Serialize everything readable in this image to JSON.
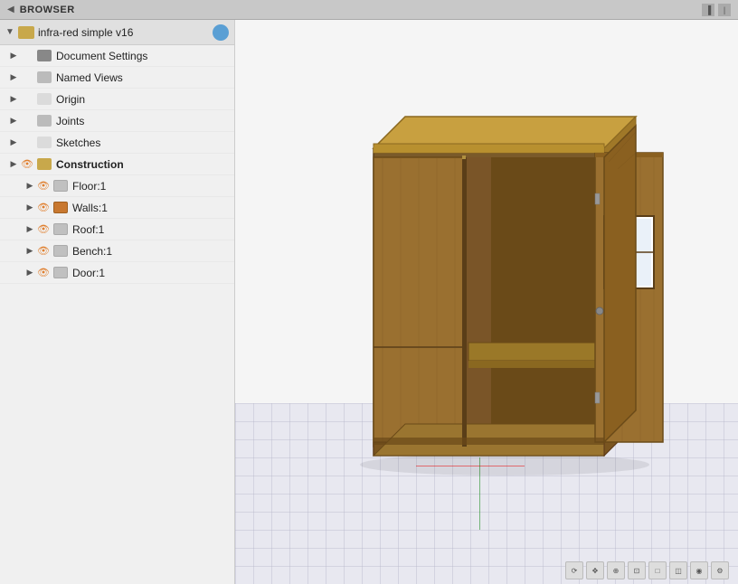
{
  "titleBar": {
    "label": "BROWSER",
    "backIcon": "◀",
    "collapseIcon": "▐▌"
  },
  "rootItem": {
    "label": "infra-red simple v16",
    "folderIcon": "folder-icon",
    "eyeIcon": "eye-icon"
  },
  "treeItems": [
    {
      "id": "doc-settings",
      "label": "Document Settings",
      "indent": 1,
      "hasExpand": true,
      "iconType": "icon-gear",
      "hasEye": false,
      "eyeOpen": false
    },
    {
      "id": "named-views",
      "label": "Named Views",
      "indent": 1,
      "hasExpand": true,
      "iconType": "icon-folder-gray",
      "hasEye": false,
      "eyeOpen": false
    },
    {
      "id": "origin",
      "label": "Origin",
      "indent": 1,
      "hasExpand": true,
      "iconType": "icon-folder-gray",
      "hasEye": false,
      "eyeOpen": false,
      "iconDimmed": true
    },
    {
      "id": "joints",
      "label": "Joints",
      "indent": 1,
      "hasExpand": true,
      "iconType": "icon-folder-gray",
      "hasEye": false,
      "eyeOpen": false
    },
    {
      "id": "sketches",
      "label": "Sketches",
      "indent": 1,
      "hasExpand": true,
      "iconType": "icon-folder-gray",
      "hasEye": false,
      "eyeOpen": false,
      "iconDimmed": true
    },
    {
      "id": "construction",
      "label": "Construction",
      "indent": 1,
      "hasExpand": true,
      "iconType": "icon-folder-brown",
      "hasEye": true,
      "eyeOpen": true
    },
    {
      "id": "floor1",
      "label": "Floor:1",
      "indent": 2,
      "hasExpand": true,
      "iconType": "icon-box-gray",
      "hasEye": true,
      "eyeOpen": true
    },
    {
      "id": "walls1",
      "label": "Walls:1",
      "indent": 2,
      "hasExpand": true,
      "iconType": "icon-box-orange",
      "hasEye": true,
      "eyeOpen": true
    },
    {
      "id": "roof1",
      "label": "Roof:1",
      "indent": 2,
      "hasExpand": true,
      "iconType": "icon-box-gray",
      "hasEye": true,
      "eyeOpen": true
    },
    {
      "id": "bench1",
      "label": "Bench:1",
      "indent": 2,
      "hasExpand": true,
      "iconType": "icon-box-gray",
      "hasEye": true,
      "eyeOpen": true
    },
    {
      "id": "door1",
      "label": "Door:1",
      "indent": 2,
      "hasExpand": true,
      "iconType": "icon-box-gray",
      "hasEye": true,
      "eyeOpen": true
    }
  ],
  "viewport": {
    "bgColor": "#f5f5f5"
  }
}
